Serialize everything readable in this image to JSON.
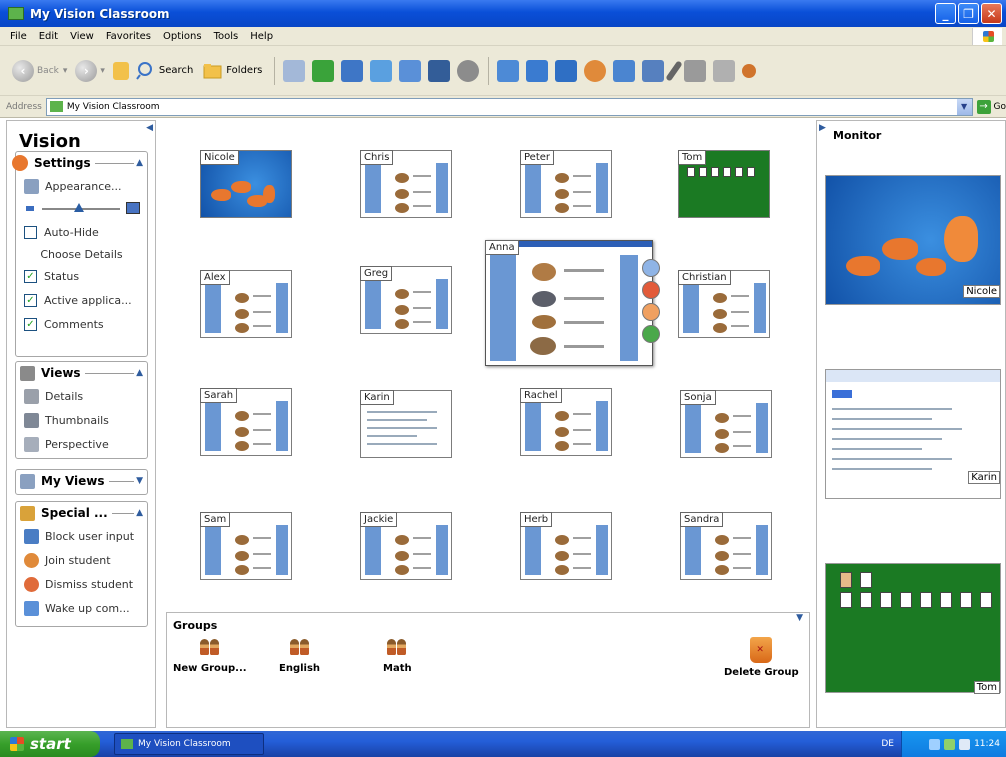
{
  "window": {
    "title": "My Vision Classroom",
    "controls": [
      "_",
      "❐",
      "✕"
    ]
  },
  "menu": [
    "File",
    "Edit",
    "View",
    "Favorites",
    "Options",
    "Tools",
    "Help"
  ],
  "toolbar": {
    "back_label": "Back",
    "search_label": "Search",
    "folders_label": "Folders",
    "icons": [
      {
        "name": "arrange-icon",
        "color": "#a3b8d8"
      },
      {
        "name": "timer-icon",
        "color": "#3aa33a"
      },
      {
        "name": "thumbnails-icon",
        "color": "#3e76c6"
      },
      {
        "name": "monitor-icon",
        "color": "#5aa0e0"
      },
      {
        "name": "share-screen-icon",
        "color": "#5a90d8"
      },
      {
        "name": "blank-screen-icon",
        "color": "#335d98"
      },
      {
        "name": "stop-icon",
        "color": "#8c8c8c"
      },
      {
        "name": "show-screen-icon",
        "color": "#4d8ad6"
      },
      {
        "name": "remote-control-icon",
        "color": "#3a7bd0"
      },
      {
        "name": "view-screen-icon",
        "color": "#2f6fc4"
      },
      {
        "name": "help-request-icon",
        "color": "#e08a3a"
      },
      {
        "name": "test-icon",
        "color": "#4b85d0"
      },
      {
        "name": "lock-icon",
        "color": "#5680bf"
      },
      {
        "name": "pencil-icon",
        "color": "#666666"
      },
      {
        "name": "web-limit-icon",
        "color": "#9a9a9a"
      },
      {
        "name": "app-limit-icon",
        "color": "#b0b0b0"
      },
      {
        "name": "tools-icon",
        "color": "#d0742c"
      }
    ]
  },
  "address": {
    "label": "Address",
    "value": "My Vision Classroom",
    "go_label": "Go"
  },
  "left_panel": {
    "title": "Vision",
    "settings": {
      "title": "Settings",
      "appearance": "Appearance...",
      "auto_hide": "Auto-Hide",
      "choose_details": "Choose Details",
      "details": [
        {
          "label": "Status",
          "checked": true
        },
        {
          "label": "Active applica...",
          "checked": true
        },
        {
          "label": "Comments",
          "checked": true
        }
      ]
    },
    "views": {
      "title": "Views",
      "items": [
        "Details",
        "Thumbnails",
        "Perspective"
      ]
    },
    "my_views": {
      "title": "My Views"
    },
    "special": {
      "title": "Special ...",
      "items": [
        "Block user input",
        "Join student",
        "Dismiss student",
        "Wake up com..."
      ]
    }
  },
  "students": [
    {
      "name": "Nicole",
      "screen": "fish"
    },
    {
      "name": "Chris",
      "screen": "doc"
    },
    {
      "name": "Peter",
      "screen": "doc"
    },
    {
      "name": "Tom",
      "screen": "solitaire"
    },
    {
      "name": "Alex",
      "screen": "doc"
    },
    {
      "name": "Greg",
      "screen": "doc"
    },
    {
      "name": "Anna",
      "screen": "doc"
    },
    {
      "name": "Christian",
      "screen": "doc"
    },
    {
      "name": "Sarah",
      "screen": "doc"
    },
    {
      "name": "Karin",
      "screen": "web"
    },
    {
      "name": "Rachel",
      "screen": "doc"
    },
    {
      "name": "Sonja",
      "screen": "doc"
    },
    {
      "name": "Sam",
      "screen": "doc"
    },
    {
      "name": "Jackie",
      "screen": "doc"
    },
    {
      "name": "Herb",
      "screen": "doc"
    },
    {
      "name": "Sandra",
      "screen": "doc"
    }
  ],
  "groups": {
    "title": "Groups",
    "items": [
      "New Group...",
      "English",
      "Math"
    ],
    "delete_label": "Delete Group"
  },
  "monitor": {
    "title": "Monitor",
    "screens": [
      "Nicole",
      "Karin",
      "Tom"
    ]
  },
  "taskbar": {
    "start_label": "start",
    "task_label": "My Vision Classroom",
    "language": "DE",
    "clock": "11:24"
  }
}
